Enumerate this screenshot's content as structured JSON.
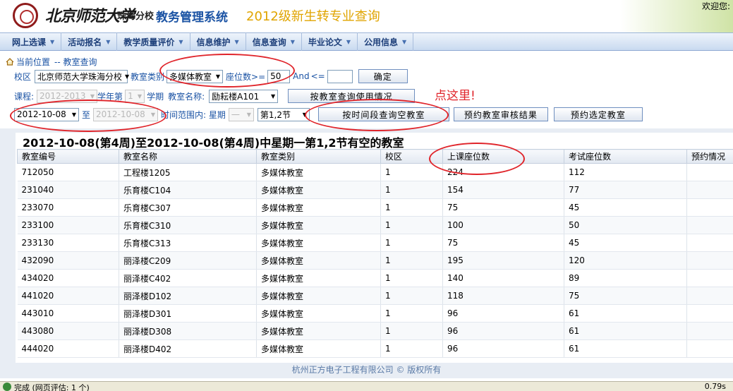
{
  "header": {
    "logo_text": "北京师范大学",
    "branch": "珠海分校",
    "system_title": "教务管理系统",
    "page_heading": "2012级新生转专业查询",
    "welcome": "欢迎您:"
  },
  "menu": [
    {
      "label": "网上选课"
    },
    {
      "label": "活动报名"
    },
    {
      "label": "教学质量评价"
    },
    {
      "label": "信息维护"
    },
    {
      "label": "信息查询"
    },
    {
      "label": "毕业论文"
    },
    {
      "label": "公用信息"
    }
  ],
  "location": {
    "label": "当前位置",
    "path": "-- 教室查询"
  },
  "filters": {
    "campus_label": "校区",
    "campus_value": "北京师范大学珠海分校",
    "room_type_label": "教室类别",
    "room_type_value": "多媒体教室",
    "seats_label": "座位数>=",
    "seats_min": "50",
    "and_label": "And",
    "le_label": "<=",
    "seats_max": "",
    "confirm_button": "确定",
    "course_label": "课程:",
    "year_value": "2012-2013",
    "year_label": "学年第",
    "term_value": "1",
    "term_label": "学期",
    "room_name_label": "教室名称:",
    "room_name_value": "励耘楼A101",
    "room_usage_button": "按教室查询使用情况",
    "hint": "点这里!",
    "date_from": "2012-10-08",
    "to_label": "至",
    "date_to": "2012-10-08",
    "time_range_label": "时间范围内: 星期",
    "weekday_value": "一",
    "period_value": "第1,2节",
    "free_room_button": "按时间段查询空教室",
    "review_button": "预约教室审核结果",
    "reserve_button": "预约选定教室"
  },
  "result": {
    "title": "2012-10-08(第4周)至2012-10-08(第4周)中星期一第1,2节有空的教室",
    "columns": [
      "教室编号",
      "教室名称",
      "教室类别",
      "校区",
      "上课座位数",
      "考试座位数",
      "预约情况"
    ],
    "rows": [
      [
        "712050",
        "工程楼1205",
        "多媒体教室",
        "1",
        "224",
        "112",
        ""
      ],
      [
        "231040",
        "乐育楼C104",
        "多媒体教室",
        "1",
        "154",
        "77",
        ""
      ],
      [
        "233070",
        "乐育楼C307",
        "多媒体教室",
        "1",
        "75",
        "45",
        ""
      ],
      [
        "233100",
        "乐育楼C310",
        "多媒体教室",
        "1",
        "100",
        "50",
        ""
      ],
      [
        "233130",
        "乐育楼C313",
        "多媒体教室",
        "1",
        "75",
        "45",
        ""
      ],
      [
        "432090",
        "丽泽楼C209",
        "多媒体教室",
        "1",
        "195",
        "120",
        ""
      ],
      [
        "434020",
        "丽泽楼C402",
        "多媒体教室",
        "1",
        "140",
        "89",
        ""
      ],
      [
        "441020",
        "丽泽楼D102",
        "多媒体教室",
        "1",
        "118",
        "75",
        ""
      ],
      [
        "443010",
        "丽泽楼D301",
        "多媒体教室",
        "1",
        "96",
        "61",
        ""
      ],
      [
        "443080",
        "丽泽楼D308",
        "多媒体教室",
        "1",
        "96",
        "61",
        ""
      ],
      [
        "444020",
        "丽泽楼D402",
        "多媒体教室",
        "1",
        "96",
        "61",
        ""
      ]
    ]
  },
  "footer": "杭州正方电子工程有限公司 © 版权所有",
  "statusbar": {
    "text": "完成 (网页评估: 1 个)",
    "zoom": "0.79s"
  },
  "colors": {
    "accent": "#1b53a4",
    "heading_gold": "#e0a400",
    "annotation_red": "#e0242a"
  }
}
